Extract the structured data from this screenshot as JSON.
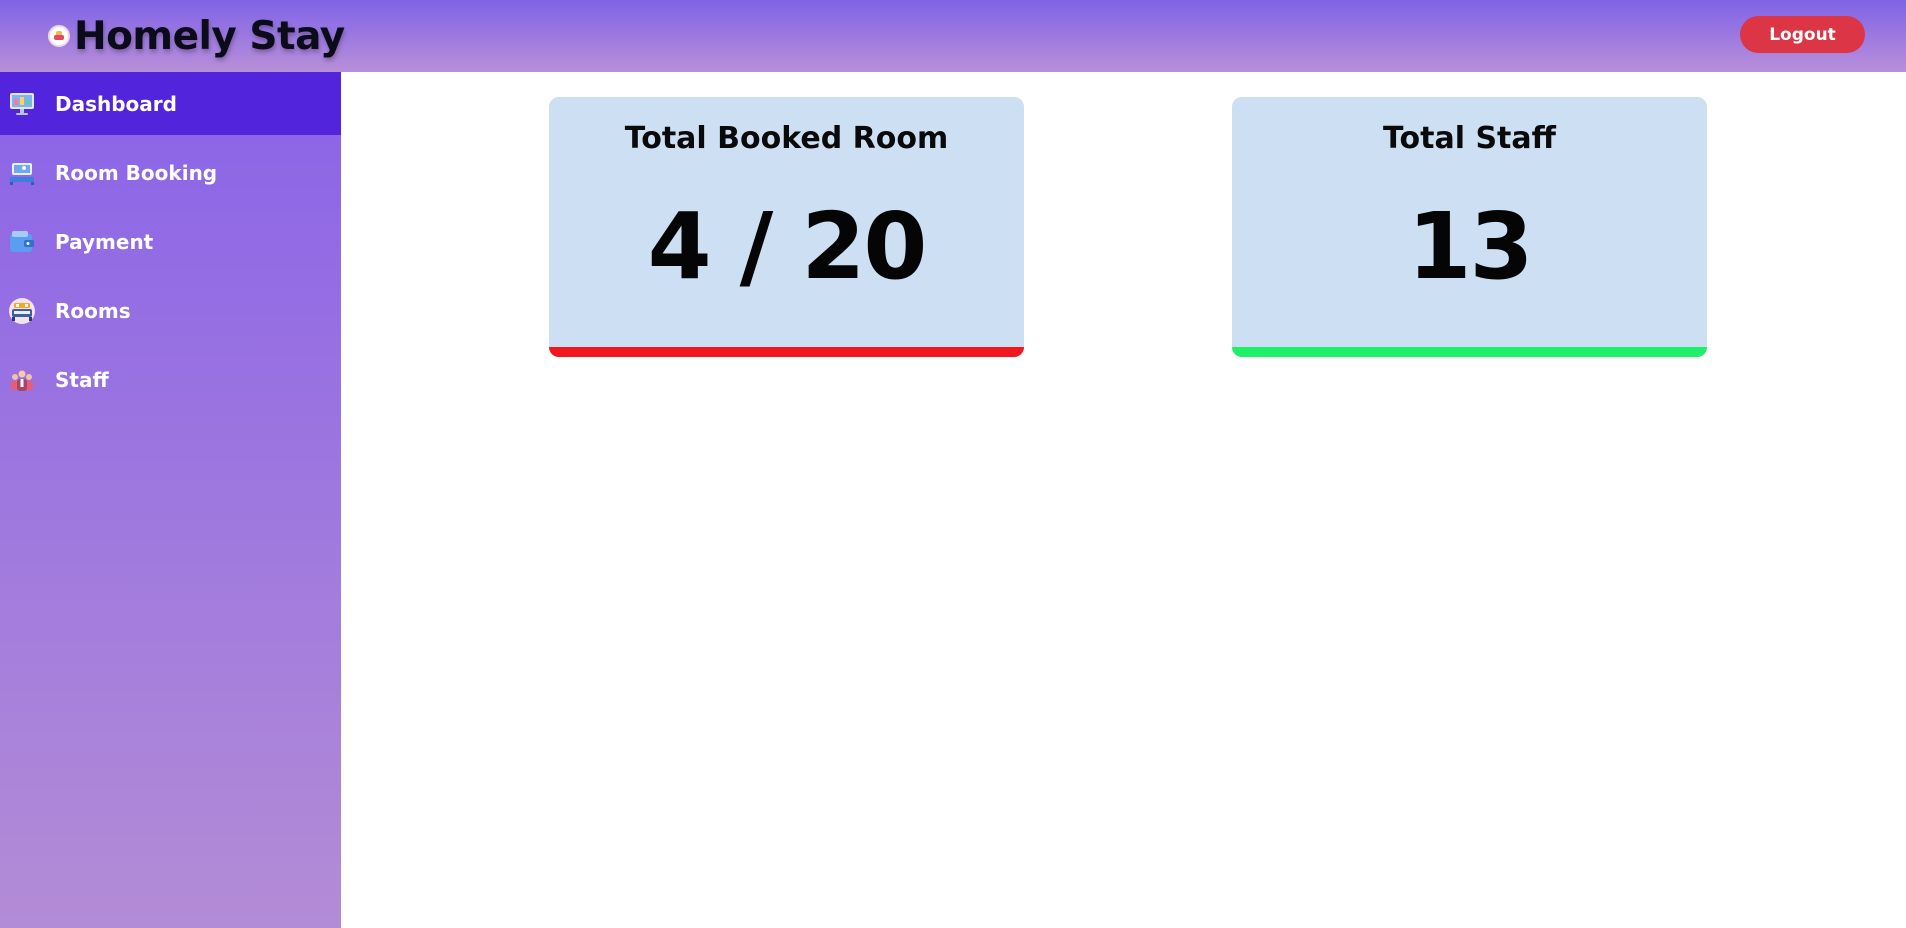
{
  "header": {
    "brand_name": "Homely Stay",
    "logout_label": "Logout",
    "logout_color": "#dc3545",
    "logo_icon": "hotel-logo-icon"
  },
  "sidebar": {
    "items": [
      {
        "label": "Dashboard",
        "icon": "monitor-icon",
        "active": true
      },
      {
        "label": "Room Booking",
        "icon": "bed-booking-icon",
        "active": false
      },
      {
        "label": "Payment",
        "icon": "wallet-icon",
        "active": false
      },
      {
        "label": "Rooms",
        "icon": "bed-icon",
        "active": false
      },
      {
        "label": "Staff",
        "icon": "staff-people-icon",
        "active": false
      }
    ],
    "active_color": "#5224dc"
  },
  "cards": [
    {
      "title": "Total Booked Room",
      "value": "4 / 20",
      "accent": "#f0181d"
    },
    {
      "title": "Total Staff",
      "value": "13",
      "accent": "#1ef06a"
    }
  ]
}
